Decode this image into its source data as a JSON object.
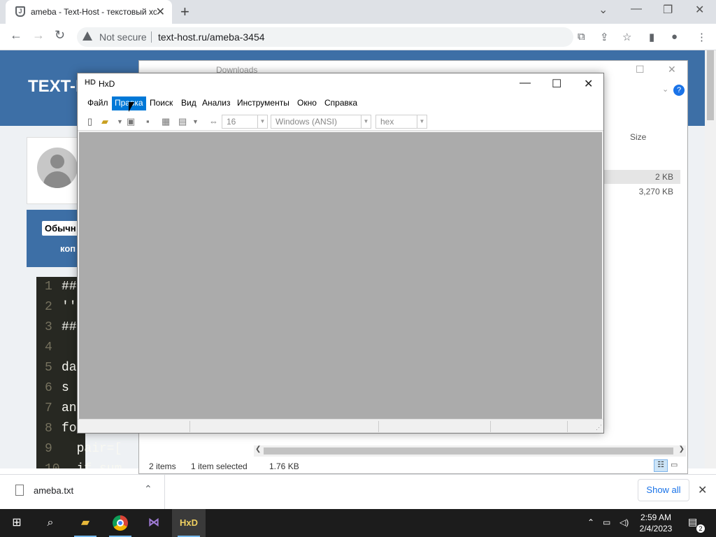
{
  "browser": {
    "tab_title": "ameba - Text-Host - текстовый хостинг",
    "tab_favicon_letter": "J",
    "security_label": "Not secure",
    "url": "text-host.ru/ameba-3454"
  },
  "page": {
    "logo_text": "TEXT-H",
    "type_pill": "Обычн",
    "copy_label": "коп",
    "code_lines": [
      {
        "n": "1",
        "t": "##"
      },
      {
        "n": "2",
        "t": "''"
      },
      {
        "n": "3",
        "t": "##"
      },
      {
        "n": "4",
        "t": ""
      },
      {
        "n": "5",
        "t": "da"
      },
      {
        "n": "6",
        "t": "s "
      },
      {
        "n": "7",
        "t": "an"
      },
      {
        "n": "8",
        "t": "fo"
      },
      {
        "n": "9",
        "t": "  pair=["
      },
      {
        "n": "10",
        "t": "  if sum"
      }
    ]
  },
  "explorer": {
    "title": "Downloads",
    "size_header": "Size",
    "rows": [
      {
        "size": "2 KB"
      },
      {
        "size": "3,270 KB"
      }
    ],
    "status_items": "2 items",
    "status_selected": "1 item selected",
    "status_size": "1.76 KB"
  },
  "hxd": {
    "title": "HxD",
    "menu": [
      "Файл",
      "Правка",
      "Поиск",
      "Вид",
      "Анализ",
      "Инструменты",
      "Окно",
      "Справка"
    ],
    "active_menu": "Правка",
    "bytes_per_row": "16",
    "charset": "Windows (ANSI)",
    "offset_base": "hex"
  },
  "downloads_bar": {
    "file_name": "ameba.txt",
    "show_all": "Show all"
  },
  "taskbar": {
    "time": "2:59 AM",
    "date": "2/4/2023",
    "notification_count": "2"
  },
  "colors": {
    "site_header": "#3d6fa6",
    "menu_highlight": "#0078d7",
    "hxd_canvas": "#ababab",
    "taskbar": "#1c1c1c"
  }
}
